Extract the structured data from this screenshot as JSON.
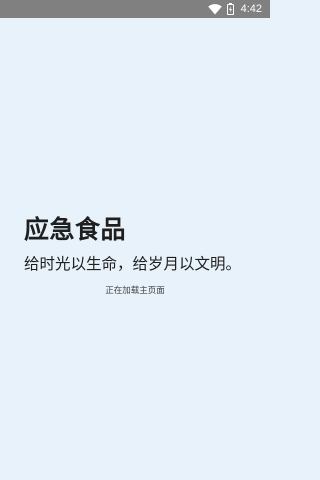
{
  "status_bar": {
    "time": "4:42",
    "background": "#808080",
    "icons": [
      "wifi-icon",
      "battery-icon"
    ]
  },
  "splash": {
    "app_name": "应急食品",
    "slogan": "给时光以生命，给岁月以文明。",
    "loading_text": "正在加载主页面",
    "background": "#e8f2fa"
  }
}
